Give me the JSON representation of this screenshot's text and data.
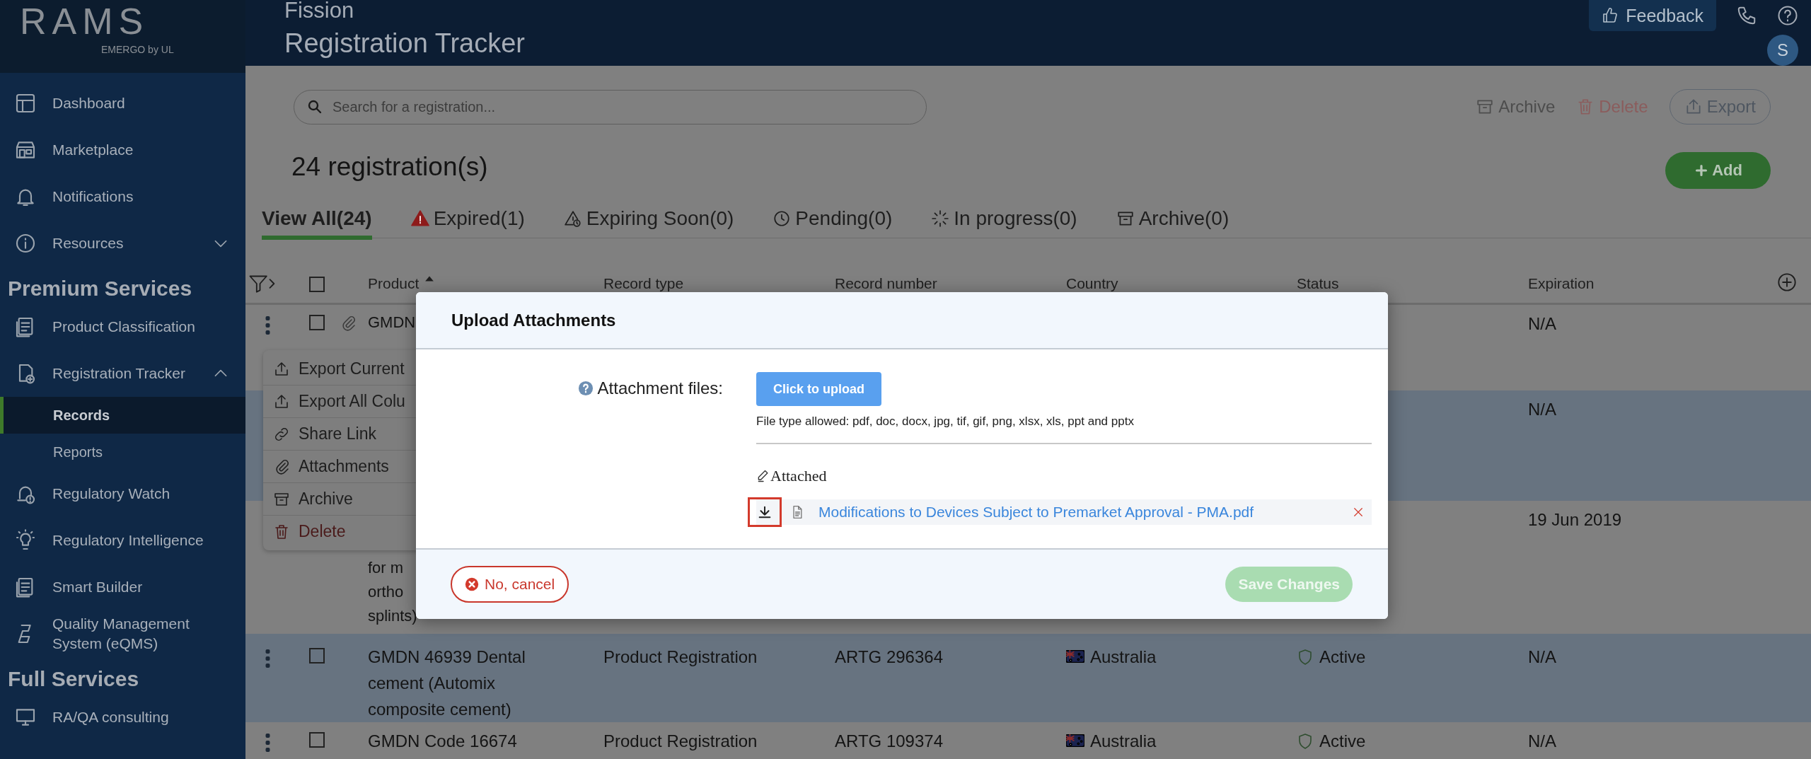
{
  "sidebar": {
    "logo": {
      "wordmark": "RAMS",
      "tagline": "EMERGO by UL"
    },
    "items": [
      {
        "label": "Dashboard"
      },
      {
        "label": "Marketplace"
      },
      {
        "label": "Notifications"
      },
      {
        "label": "Resources",
        "expanded": false
      }
    ],
    "sections": [
      {
        "title": "Premium Services",
        "items": [
          {
            "label": "Product Classification"
          },
          {
            "label": "Registration Tracker",
            "expanded": true,
            "children": [
              {
                "label": "Records",
                "selected": true
              },
              {
                "label": "Reports",
                "selected": false
              }
            ]
          },
          {
            "label": "Regulatory Watch"
          },
          {
            "label": "Regulatory Intelligence"
          },
          {
            "label": "Smart Builder"
          },
          {
            "label": "Quality Management System (eQMS)"
          }
        ]
      },
      {
        "title": "Full Services",
        "items": [
          {
            "label": "RA/QA consulting"
          }
        ]
      }
    ]
  },
  "header": {
    "org": "Fission",
    "title": "Registration Tracker",
    "feedback": "Feedback",
    "avatar": "S"
  },
  "toolbar": {
    "search_placeholder": "Search for a registration...",
    "actions": [
      {
        "label": "Archive",
        "kind": "plain"
      },
      {
        "label": "Delete",
        "kind": "danger"
      },
      {
        "label": "Export",
        "kind": "outline"
      }
    ],
    "count": "24 registration(s)",
    "add": "Add"
  },
  "tabs": [
    {
      "label": "View All(24)",
      "selected": true
    },
    {
      "label": "Expired(1)",
      "selected": false
    },
    {
      "label": "Expiring Soon(0)",
      "selected": false
    },
    {
      "label": "Pending(0)",
      "selected": false
    },
    {
      "label": "In progress(0)",
      "selected": false
    },
    {
      "label": "Archive(0)",
      "selected": false
    }
  ],
  "table": {
    "select_all_checked": false,
    "columns": [
      {
        "label": "Product",
        "sorted": true
      },
      {
        "label": "Record type",
        "sorted": false
      },
      {
        "label": "Record number",
        "sorted": false
      },
      {
        "label": "Country",
        "sorted": false
      },
      {
        "label": "Status",
        "sorted": false
      },
      {
        "label": "Expiration",
        "sorted": false
      }
    ],
    "rows": [
      {
        "checked": false,
        "attachment": true,
        "product": "GMDN",
        "expiration": "N/A"
      },
      {
        "expiration": "N/A"
      },
      {
        "product": "for m\northo\nsplints)",
        "expiration": "19 Jun 2019"
      },
      {
        "checked": false,
        "attachment": false,
        "product": "GMDN 46939 Dental cement (Automix composite cement)",
        "record_type": "Product Registration",
        "record_number": "ARTG 296364",
        "country": "Australia",
        "status": "Active",
        "expiration": "N/A"
      },
      {
        "checked": false,
        "attachment": false,
        "product": "GMDN Code 16674",
        "record_type": "Product Registration",
        "record_number": "ARTG 109374",
        "country": "Australia",
        "status": "Active",
        "expiration": "N/A"
      }
    ]
  },
  "row_menu": {
    "items": [
      {
        "label": "Export Current",
        "kind": "normal"
      },
      {
        "label": "Export All Colu",
        "kind": "normal"
      },
      {
        "label": "Share Link",
        "kind": "normal"
      },
      {
        "label": "Attachments",
        "kind": "normal"
      },
      {
        "label": "Archive",
        "kind": "normal"
      },
      {
        "label": "Delete",
        "kind": "danger"
      }
    ]
  },
  "modal": {
    "title": "Upload Attachments",
    "field_label": "Attachment files:",
    "upload_button": "Click to upload",
    "file_types": "File type allowed: pdf, doc, docx, jpg, tif, gif, png, xlsx, xls, ppt and pptx",
    "attached_heading": "Attached",
    "files": [
      {
        "name": "Modifications to Devices Subject to Premarket Approval - PMA.pdf",
        "highlighted": true
      }
    ],
    "cancel": "No, cancel",
    "save": {
      "label": "Save Changes",
      "disabled": true
    }
  }
}
